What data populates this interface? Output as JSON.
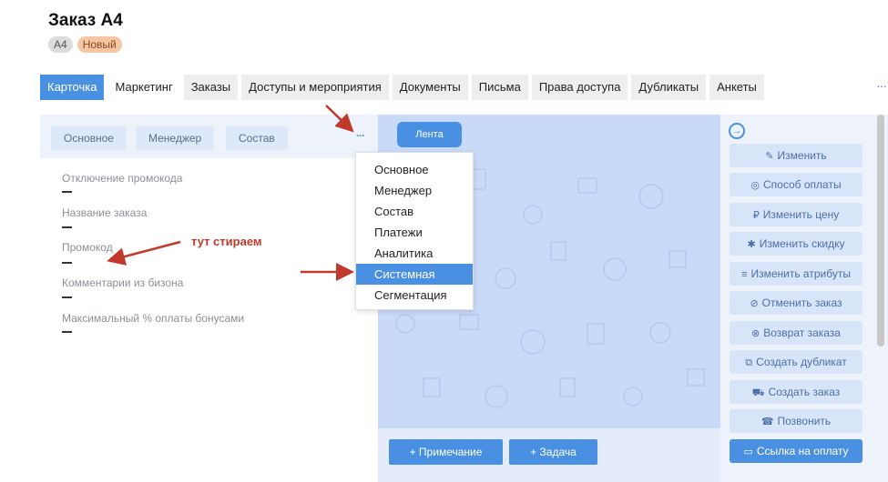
{
  "header": {
    "title": "Заказ A4",
    "badges": [
      "A4",
      "Новый"
    ]
  },
  "tabs": [
    "Карточка",
    "Маркетинг",
    "Заказы",
    "Доступы и мероприятия",
    "Документы",
    "Письма",
    "Права доступа",
    "Дубликаты",
    "Анкеты"
  ],
  "tabs_more": "···",
  "left": {
    "subtabs": [
      "Основное",
      "Менеджер",
      "Состав"
    ],
    "more": "···",
    "fields": [
      {
        "label": "Отключение промокода",
        "value": "—"
      },
      {
        "label": "Название заказа",
        "value": "—"
      },
      {
        "label": "Промокод",
        "value": "—"
      },
      {
        "label": "Комментарии из бизона",
        "value": "—"
      },
      {
        "label": "Максимальный % оплаты бонусами",
        "value": "—"
      }
    ]
  },
  "center": {
    "feed_button": "Лента",
    "note_button": "+ Примечание",
    "task_button": "+ Задача"
  },
  "dropdown": {
    "items": [
      "Основное",
      "Менеджер",
      "Состав",
      "Платежи",
      "Аналитика",
      "Системная",
      "Сегментация"
    ],
    "selected_index": 5
  },
  "actions": [
    {
      "icon": "✎",
      "icon_name": "user-edit-icon",
      "label": "Изменить"
    },
    {
      "icon": "◎",
      "icon_name": "payment-method-icon",
      "label": "Способ оплаты"
    },
    {
      "icon": "₽",
      "icon_name": "ruble-icon",
      "label": "Изменить цену"
    },
    {
      "icon": "✱",
      "icon_name": "discount-icon",
      "label": "Изменить скидку"
    },
    {
      "icon": "≡",
      "icon_name": "attributes-icon",
      "label": "Изменить атрибуты"
    },
    {
      "icon": "⊘",
      "icon_name": "cancel-icon",
      "label": "Отменить заказ"
    },
    {
      "icon": "⊗",
      "icon_name": "return-icon",
      "label": "Возврат заказа"
    },
    {
      "icon": "⧉",
      "icon_name": "duplicate-icon",
      "label": "Создать дубликат"
    },
    {
      "icon": "⛟",
      "icon_name": "cart-icon",
      "label": "Создать заказ"
    },
    {
      "icon": "☎",
      "icon_name": "phone-icon",
      "label": "Позвонить"
    },
    {
      "icon": "▭",
      "icon_name": "card-icon",
      "label": "Ссылка на оплату"
    }
  ],
  "annotation": "тут стираем",
  "colors": {
    "accent": "#4a90e2",
    "annotation": "#c0392b",
    "badge_new": "#f5c6a3"
  }
}
